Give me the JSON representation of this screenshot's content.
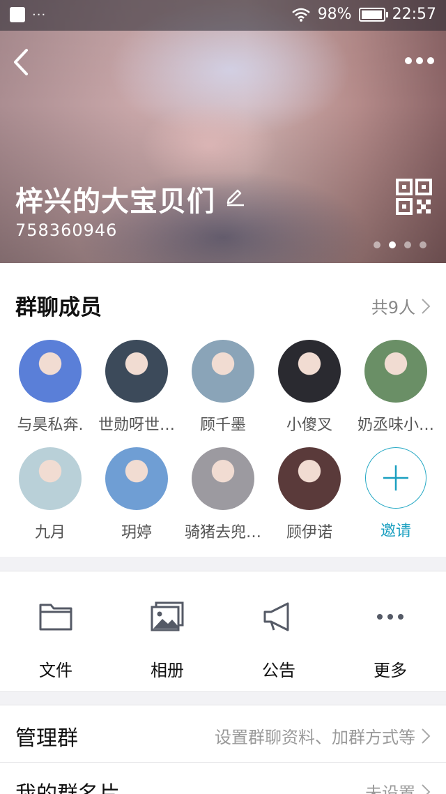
{
  "status_bar": {
    "signal_strength_pct": 98,
    "battery_text": "98%",
    "time": "22:57",
    "menu_dots": "···"
  },
  "header": {
    "group_name": "梓兴的大宝贝们",
    "group_id": "758360946",
    "pager_active_index": 1,
    "pager_count": 4
  },
  "members": {
    "title": "群聊成员",
    "count_label": "共9人",
    "list": [
      {
        "name": "与昊私奔.",
        "color": "#5a7fd8"
      },
      {
        "name": "世勋呀世…",
        "color": "#3c4a5a"
      },
      {
        "name": "顾千墨",
        "color": "#8aa4b8"
      },
      {
        "name": "小傻叉",
        "color": "#2a2a30"
      },
      {
        "name": "奶丞味小…",
        "color": "#6a8f66"
      },
      {
        "name": "九月",
        "color": "#b9d0d8"
      },
      {
        "name": "玥婷",
        "color": "#6f9ed4"
      },
      {
        "name": "骑猪去兜…",
        "color": "#9c9aa0"
      },
      {
        "name": "顾伊诺",
        "color": "#5a3a3a"
      }
    ],
    "invite_label": "邀请"
  },
  "actions": {
    "files": "文件",
    "album": "相册",
    "notice": "公告",
    "more": "更多"
  },
  "settings": {
    "manage_title": "管理群",
    "manage_value": "设置群聊资料、加群方式等",
    "card_title": "我的群名片",
    "card_value": "未设置"
  },
  "colors": {
    "accent": "#1a9fc0",
    "icon_gray": "#555a66",
    "bg": "#f2f2f5"
  }
}
